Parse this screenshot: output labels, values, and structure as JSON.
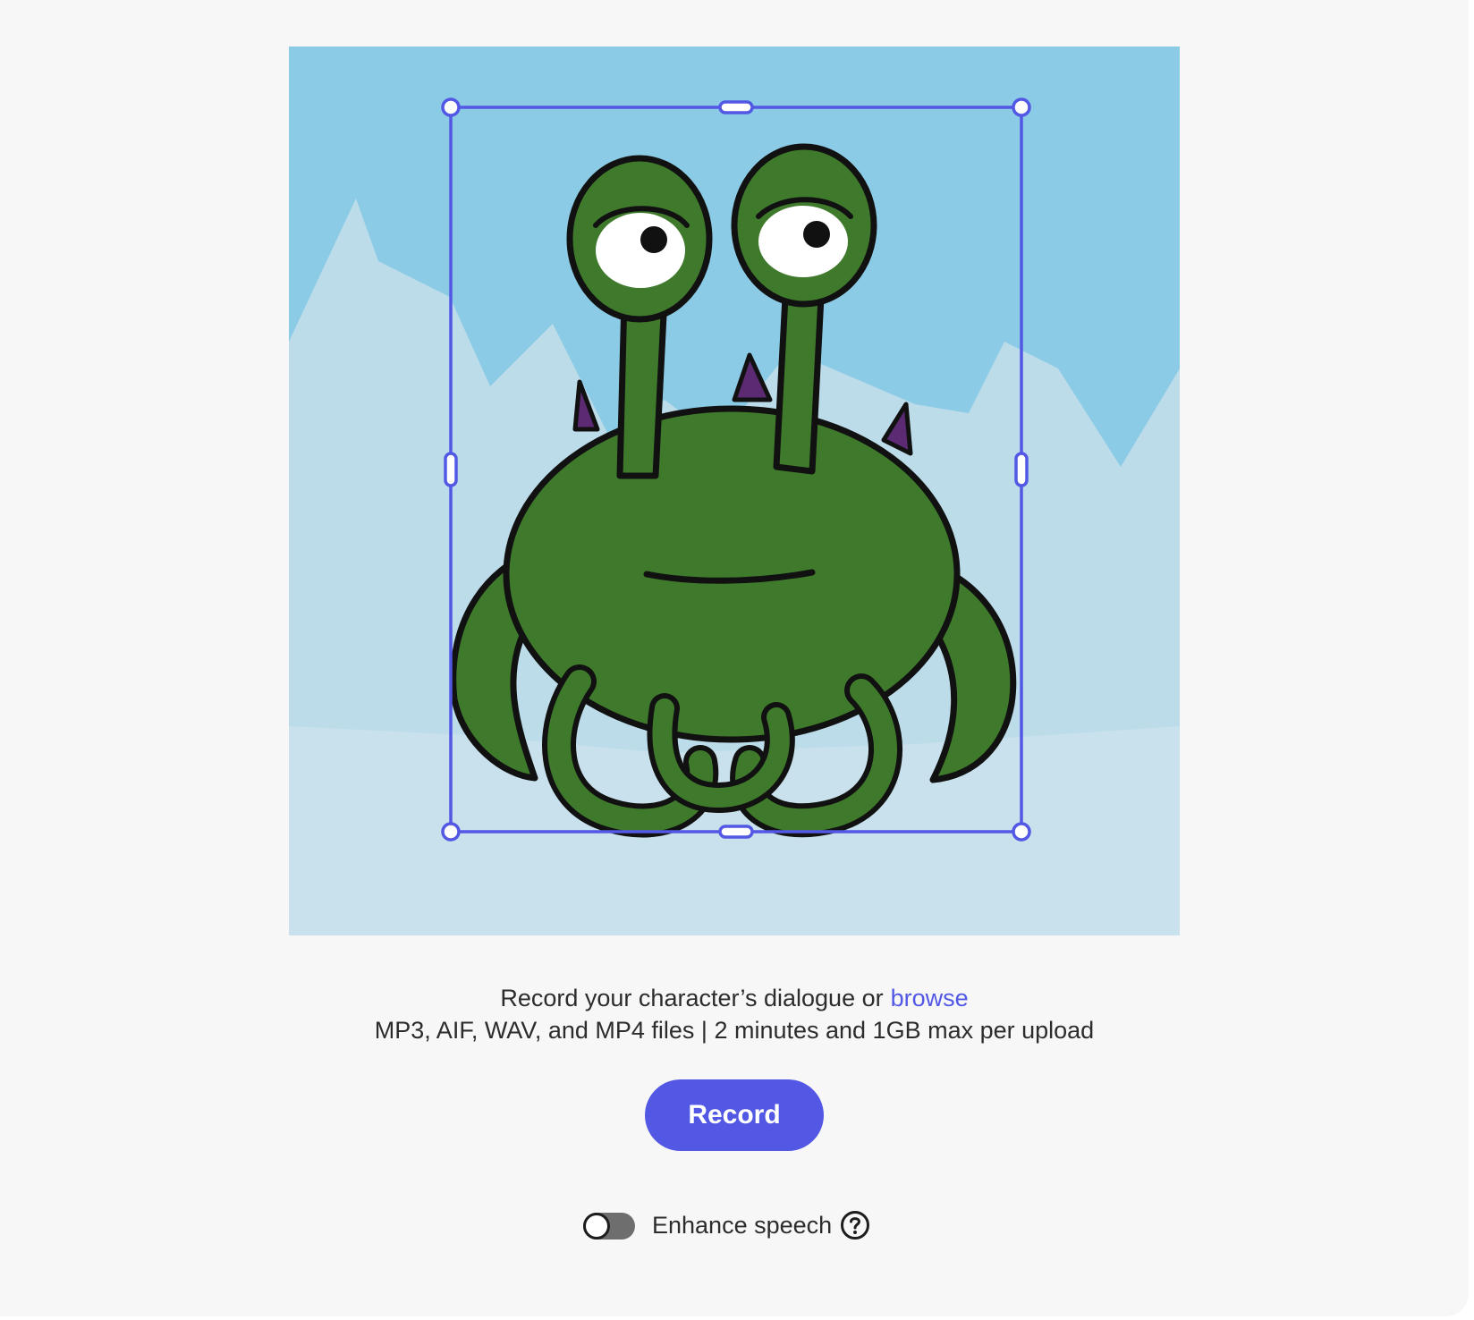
{
  "prompt": {
    "line1": "Record your character’s dialogue or",
    "browse_label": "browse",
    "line2": "MP3, AIF, WAV, and MP4 files | 2 minutes and 1GB max per upload"
  },
  "record_button": {
    "label": "Record"
  },
  "enhance_speech": {
    "label": "Enhance speech",
    "enabled": false
  },
  "icons": {
    "help": "question-mark-circle-icon",
    "selection_handles": "resize-handle-icon"
  },
  "colors": {
    "accent": "#5258e4",
    "sky": "#8ccbe6",
    "mountain": "#bcdcea",
    "character_body": "#3f7a2c",
    "page_background": "#f7f7f7"
  }
}
